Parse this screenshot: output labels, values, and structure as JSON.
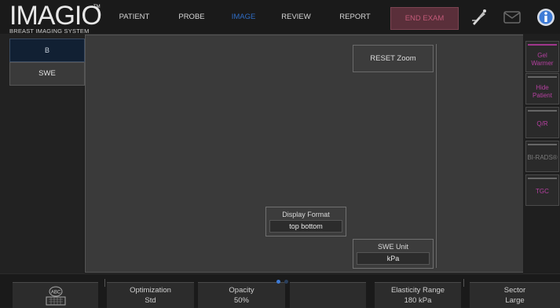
{
  "logo": {
    "main": "IMAGIO",
    "tm": "TM",
    "sub": "BREAST IMAGING SYSTEM"
  },
  "nav": [
    "PATIENT",
    "PROBE",
    "IMAGE",
    "REVIEW",
    "REPORT"
  ],
  "nav_active": "IMAGE",
  "end_exam": "END EXAM",
  "top_icons": [
    "probe-wand-icon",
    "mail-icon",
    "info-icon"
  ],
  "modes": {
    "b": "B",
    "swe": "SWE"
  },
  "image_area": {
    "reset_zoom": "RESET Zoom",
    "display_format": {
      "title": "Display Format",
      "value": "top bottom"
    },
    "swe_unit": {
      "title": "SWE Unit",
      "value": "kPa"
    }
  },
  "right_buttons": [
    {
      "label": "Gel Warmer",
      "state": "pink"
    },
    {
      "label": "Hide Patient",
      "state": "pink"
    },
    {
      "label": "Q/R",
      "state": "pink"
    },
    {
      "label": "BI-RADS®",
      "state": "disabled"
    },
    {
      "label": "TGC",
      "state": "pink"
    }
  ],
  "bottom": {
    "keyboard_label": "ABC",
    "optimization": {
      "label": "Optimization",
      "value": "Std"
    },
    "opacity": {
      "label": "Opacity",
      "value": "50%"
    },
    "elasticity": {
      "label": "Elasticity Range",
      "value": "180 kPa"
    },
    "sector": {
      "label": "Sector",
      "value": "Large"
    }
  },
  "colors": {
    "accent_blue": "#2f6cc4",
    "end_exam_bg": "#5a2f3a",
    "pink": "#b540a0"
  }
}
